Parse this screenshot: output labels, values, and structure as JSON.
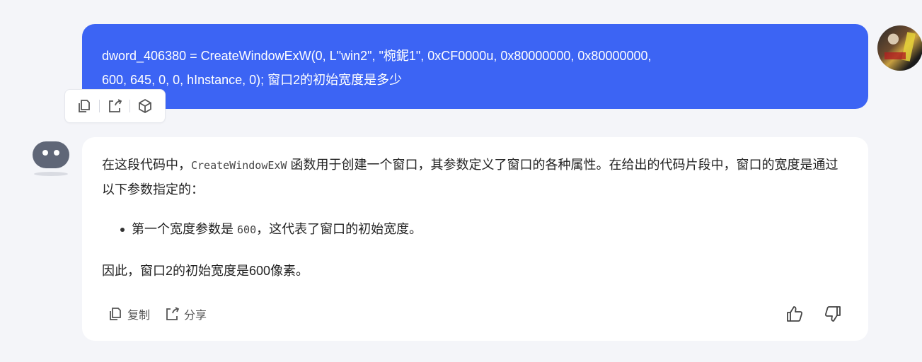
{
  "user_message": {
    "line1": "dword_406380 = CreateWindowExW(0, L\"win2\", \"椀鈮1\", 0xCF0000u, 0x80000000, 0x80000000,",
    "line2": "600, 645, 0, 0, hInstance, 0);  窗口2的初始宽度是多少"
  },
  "message_tools": [
    "copy-icon",
    "share-icon",
    "cube-icon"
  ],
  "bot_message": {
    "intro_before": "在这段代码中，",
    "intro_code": "CreateWindowExW",
    "intro_after": " 函数用于创建一个窗口，其参数定义了窗口的各种属性。在给出的代码片段中，窗口的宽度是通过以下参数指定的：",
    "bullet_before": "第一个宽度参数是 ",
    "bullet_code": "600",
    "bullet_after": "，这代表了窗口的初始宽度。",
    "conclusion": "因此，窗口2的初始宽度是600像素。"
  },
  "actions": {
    "copy_label": "复制",
    "share_label": "分享"
  },
  "colors": {
    "user_bubble": "#3c64f4",
    "bot_bubble": "#ffffff",
    "background": "#f4f5f9"
  }
}
